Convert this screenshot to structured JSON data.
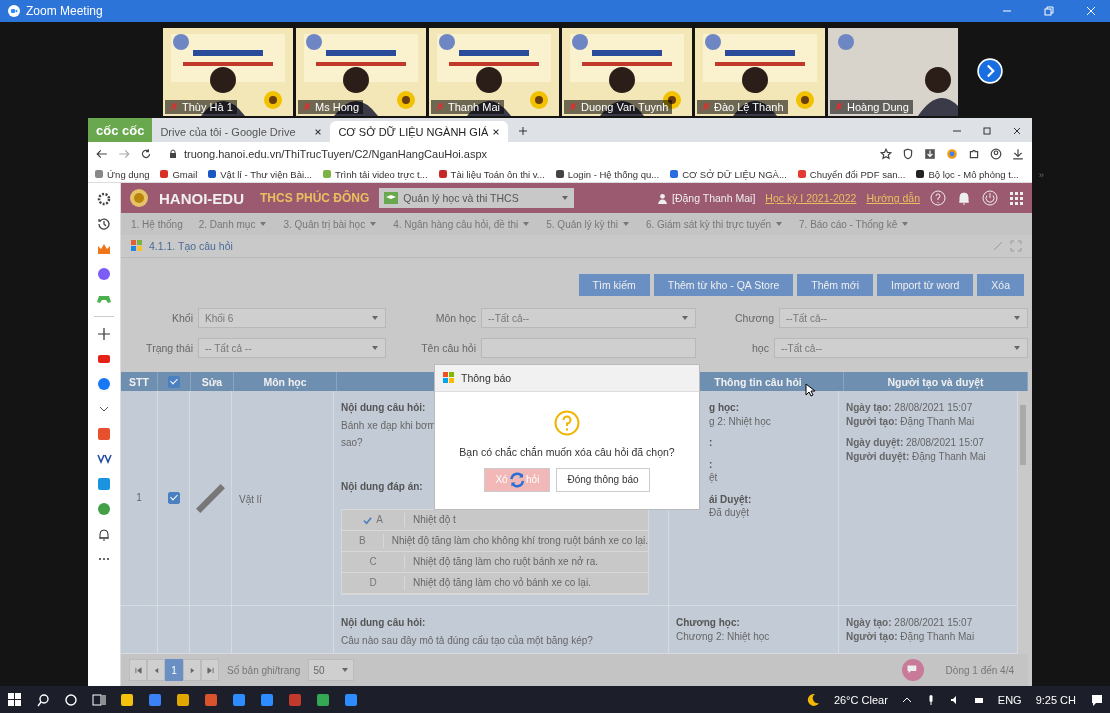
{
  "zoom": {
    "title": "Zoom Meeting",
    "participants": [
      {
        "name": "Thùy Hà 1",
        "muted": true
      },
      {
        "name": "Ms Hong",
        "muted": true
      },
      {
        "name": "Thanh Mai",
        "muted": true
      },
      {
        "name": "Duong Van Tuynh",
        "muted": true
      },
      {
        "name": "Đào Lệ Thanh",
        "muted": true
      },
      {
        "name": "Hoàng Dung",
        "muted": true
      }
    ]
  },
  "browser": {
    "brand": "cốc cốc",
    "tabs": [
      {
        "label": "Drive của tôi - Google Drive",
        "selected": false
      },
      {
        "label": "CƠ SỞ DỮ LIỆU NGÀNH GIÁ",
        "selected": true
      }
    ],
    "url": "truong.hanoi.edu.vn/ThiTrucTuyen/C2/NganHangCauHoi.aspx",
    "bookmarks": [
      "Ứng dụng",
      "Gmail",
      "Vật lí - Thư viện Bài...",
      "Trình tải video trực t...",
      "Tài liệu Toán ôn thi v...",
      "Login - Hệ thống qu...",
      "CƠ SỞ DỮ LIỆU NGÀ...",
      "Chuyển đổi PDF san...",
      "Bộ lọc - Mô phỏng t..."
    ],
    "more_bookmarks": "»"
  },
  "app": {
    "brand": "HANOI-EDU",
    "school": "THCS PHÚC ĐÔNG",
    "module": "Quản lý học và thi THCS",
    "user": "[Đặng Thanh Mai]",
    "term": "Học kỳ I 2021-2022",
    "help": "Hướng dẫn",
    "menu": [
      {
        "label": "1. Hệ thống",
        "dropdown": false
      },
      {
        "label": "2. Danh mục",
        "dropdown": true
      },
      {
        "label": "3. Quản trị bài học",
        "dropdown": true
      },
      {
        "label": "4. Ngân hàng câu hỏi, đề thi",
        "dropdown": true
      },
      {
        "label": "5. Quản lý kỳ thi",
        "dropdown": true
      },
      {
        "label": "6. Giám sát kỳ thi trực tuyến",
        "dropdown": true
      },
      {
        "label": "7. Báo cáo - Thống kê",
        "dropdown": true
      }
    ],
    "page_title": "4.1.1. Tạo câu hỏi",
    "buttons": [
      "Tìm kiếm",
      "Thêm từ kho - QA Store",
      "Thêm mới",
      "Import từ word",
      "Xóa"
    ],
    "filters": [
      {
        "label": "Khối",
        "value": "Khối 6",
        "kind": "select"
      },
      {
        "label": "Môn học",
        "value": "--Tất cả--",
        "kind": "select"
      },
      {
        "label": "Chương",
        "value": "--Tất cả--",
        "kind": "select"
      },
      {
        "label": "Trạng thái",
        "value": "-- Tất cả --",
        "kind": "select"
      },
      {
        "label": "Tên câu hỏi",
        "kind": "text"
      },
      {
        "label": "học",
        "value": "--Tất cả--",
        "kind": "select"
      }
    ],
    "table": {
      "columns": [
        "STT",
        "",
        "Sửa",
        "Môn học",
        "",
        "Thông tin câu hỏi",
        "Người tạo và duyệt"
      ],
      "header_checked": true,
      "rows": [
        {
          "stt": "1",
          "checked": true,
          "subject": "Vật lí",
          "question_label": "Nội dung câu hỏi:",
          "question": [
            "Bánh xe đạp khi bơm",
            "sao?"
          ],
          "answer_label": "Nội dung đáp án:",
          "answers": [
            {
              "letter": "A",
              "correct": true,
              "text": "Nhiệt độ t"
            },
            {
              "letter": "B",
              "correct": false,
              "text": "Nhiệt độ tăng làm cho không khí trong ruột bánh xe co lại."
            },
            {
              "letter": "C",
              "correct": false,
              "text": "Nhiệt độ tăng làm cho ruột bánh xe nở ra."
            },
            {
              "letter": "D",
              "correct": false,
              "text": "Nhiệt độ tăng làm cho vỏ bánh xe co lại."
            }
          ],
          "info": [
            {
              "text": "g học:",
              "bold": true
            },
            {
              "text": "g 2: Nhiệt học",
              "bold": false
            },
            {
              "text": ":",
              "bold": true
            },
            {
              "text": ":",
              "bold": true
            },
            {
              "text": "ệt",
              "bold": false
            },
            {
              "text": "ái Duyệt:",
              "bold": true
            },
            {
              "text": "Đã duyệt",
              "bold": false
            }
          ],
          "creator": [
            "**Ngày tạo:** 28/08/2021 15:07",
            "**Người tạo:** Đặng Thanh Mai",
            "**Ngày duyệt:** 28/08/2021 15:07",
            "**Người duyệt:** Đặng Thanh Mai"
          ]
        },
        {
          "question_label": "Nội dung câu hỏi:",
          "question": [
            "Câu nào sau đây mô tả đúng cấu tạo của một băng kép?"
          ],
          "info": [
            {
              "text": "Chương học:",
              "bold": true
            },
            {
              "text": "Chương 2: Nhiệt học",
              "bold": false
            }
          ],
          "creator": [
            "**Ngày tạo:** 28/08/2021 15:07",
            "**Người tạo:** Đặng Thanh Mai"
          ]
        }
      ]
    },
    "pager": {
      "pages": [
        {
          "label": "1",
          "selected": true
        }
      ],
      "per_page_label": "Số bản ghi/trang",
      "per_page": "50",
      "summary": "Dòng 1 đến 4/4"
    },
    "dialog": {
      "title": "Thông báo",
      "message": "Bạn có chắc chắn muốn xóa câu hỏi đã chọn?",
      "confirm_left": "Xó",
      "confirm_right": "hỏi",
      "close": "Đóng thông báo"
    }
  },
  "taskbar": {
    "weather": "26°C Clear",
    "language": "ENG",
    "time": "9:25 CH"
  }
}
